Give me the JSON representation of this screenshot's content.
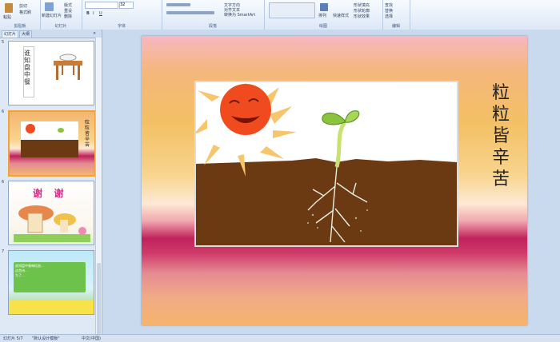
{
  "ribbon": {
    "groups": {
      "clipboard": "剪贴板",
      "slides": "幻灯片",
      "font": "字体",
      "paragraph": "段落",
      "drawing": "绘图",
      "editing": "编辑"
    },
    "clipboard": {
      "paste": "粘贴",
      "cut": "剪切",
      "format": "格式刷"
    },
    "slides": {
      "new_slide": "新建幻灯片",
      "layout": "版式",
      "reset": "重设",
      "delete": "删除"
    },
    "font": {
      "size": "32"
    },
    "paragraph": {
      "text_direction": "文字方向",
      "align_text": "对齐文本",
      "smartart": "转换为 SmartArt"
    },
    "drawing": {
      "arrange": "排列",
      "quick_styles": "快速样式",
      "fill": "形状填充",
      "outline": "形状轮廓",
      "effects": "形状效果"
    },
    "editing": {
      "find": "查找",
      "replace": "替换",
      "select": "选择"
    }
  },
  "leftpane": {
    "tab_slides": "幻灯片",
    "tab_outline": "大纲",
    "close": "×",
    "thumbs": [
      {
        "num": "5",
        "title": "谁知盘中餐"
      },
      {
        "num": "6",
        "title": "粒粒皆辛苦"
      },
      {
        "num": "6",
        "title": "谢  谢"
      },
      {
        "num": "7",
        "lines": [
          "谁知盘中餐每粒皆…",
          "这首诗…",
          "为了…"
        ]
      }
    ]
  },
  "slide": {
    "title": "粒粒皆辛苦"
  },
  "status": {
    "slide_info": "幻灯片 5/7",
    "theme": "\"默认设计模板\"",
    "language": "中文(中国)"
  }
}
